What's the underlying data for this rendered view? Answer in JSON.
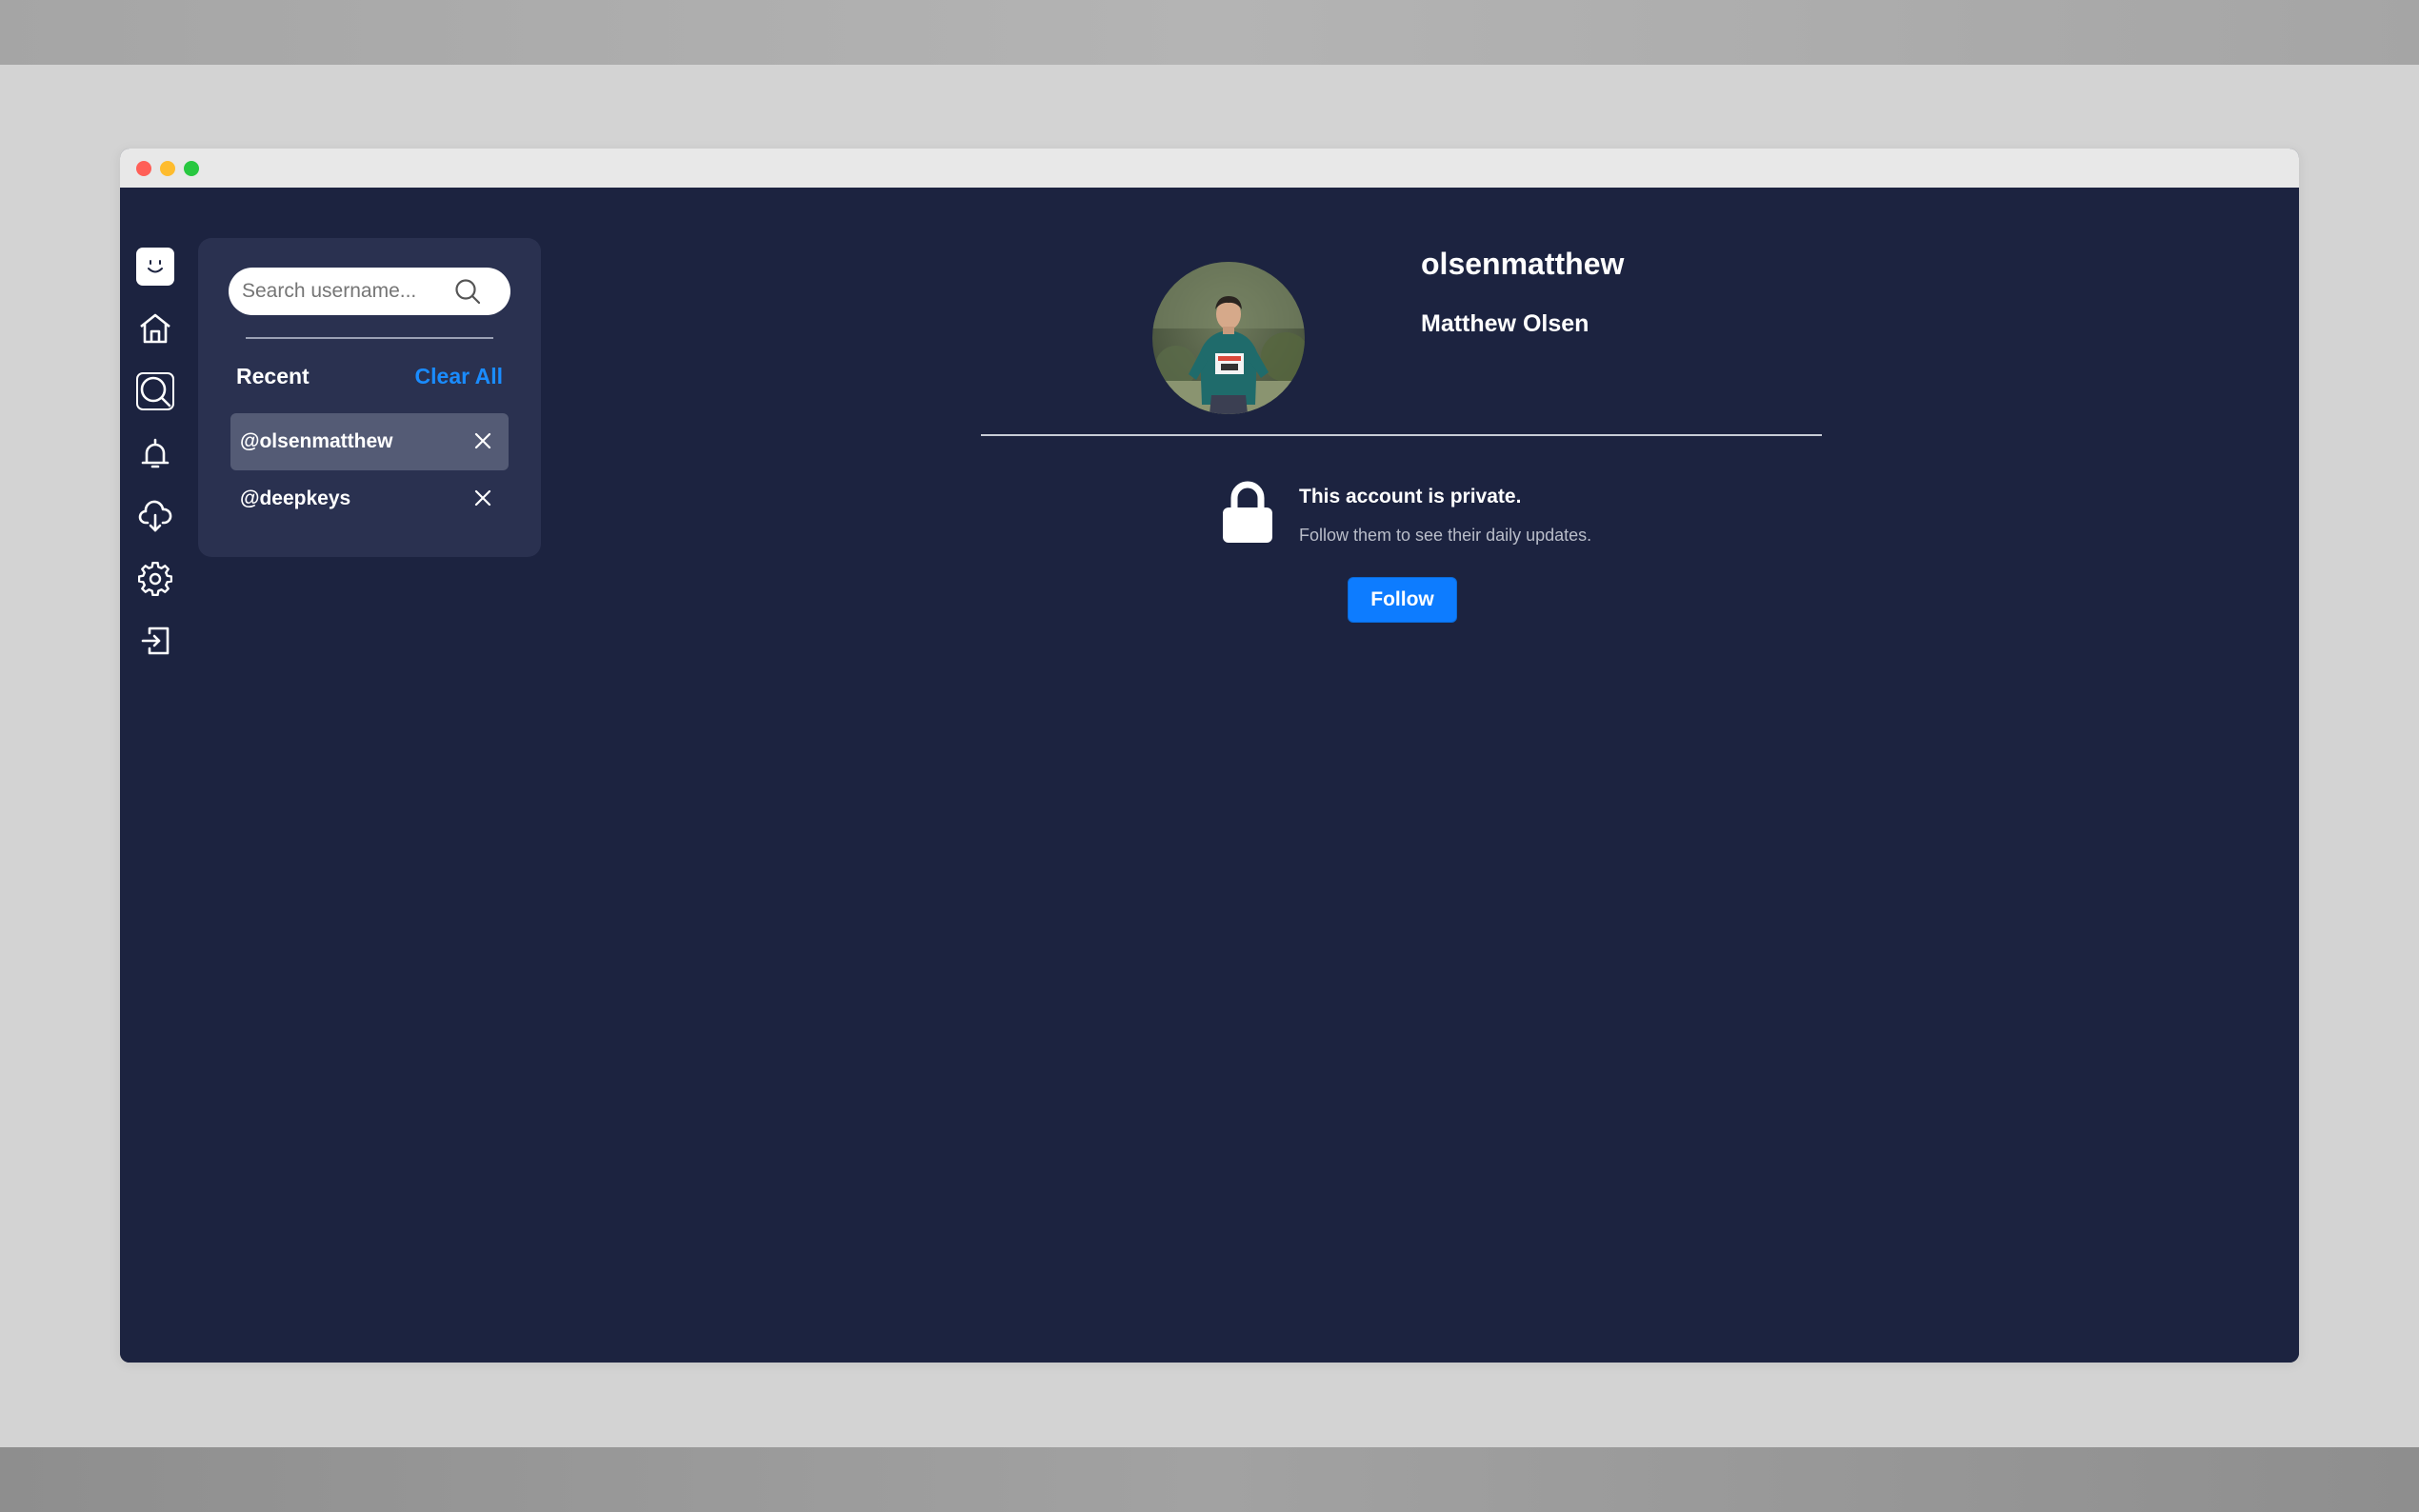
{
  "sidebar": {
    "items": [
      {
        "name": "logo",
        "icon": "face-logo-icon"
      },
      {
        "name": "home",
        "icon": "home-icon"
      },
      {
        "name": "search",
        "icon": "search-icon",
        "active": true
      },
      {
        "name": "notifications",
        "icon": "bell-icon"
      },
      {
        "name": "download",
        "icon": "cloud-download-icon"
      },
      {
        "name": "settings",
        "icon": "gear-icon"
      },
      {
        "name": "logout",
        "icon": "logout-icon"
      }
    ]
  },
  "search": {
    "placeholder": "Search username...",
    "value": "",
    "recent_label": "Recent",
    "clear_all_label": "Clear All",
    "recent": [
      {
        "handle": "@olsenmatthew",
        "highlighted": true
      },
      {
        "handle": "@deepkeys",
        "highlighted": false
      }
    ]
  },
  "profile": {
    "username": "olsenmatthew",
    "full_name": "Matthew Olsen",
    "private_title": "This account is private.",
    "private_subtitle": "Follow them to see their daily updates.",
    "follow_label": "Follow"
  },
  "colors": {
    "background": "#1c2340",
    "panel": "#2a3150",
    "accent": "#0d7cff",
    "clear_all": "#1a8cff"
  }
}
